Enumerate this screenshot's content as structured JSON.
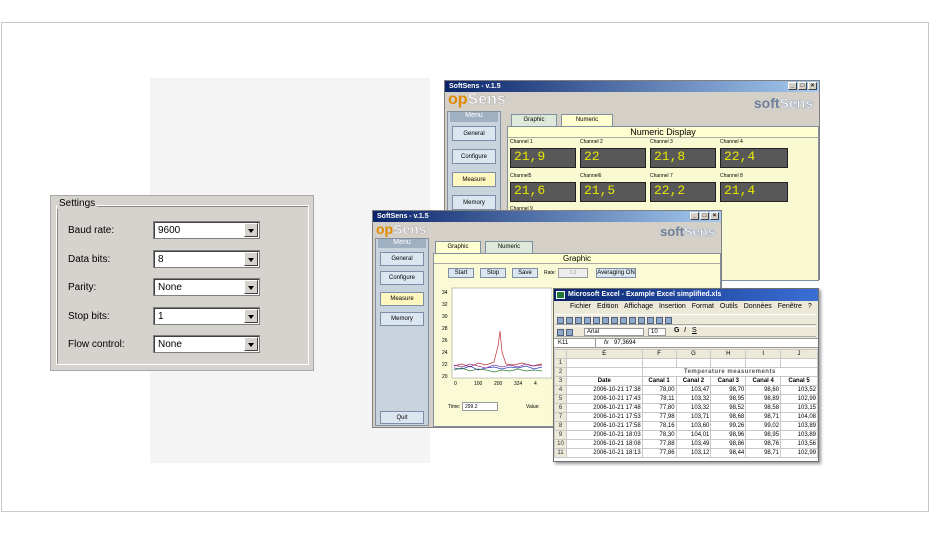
{
  "settings": {
    "title": "Settings",
    "rows": [
      {
        "label": "Baud rate:",
        "value": "9600"
      },
      {
        "label": "Data bits:",
        "value": "8"
      },
      {
        "label": "Parity:",
        "value": "None"
      },
      {
        "label": "Stop bits:",
        "value": "1"
      },
      {
        "label": "Flow control:",
        "value": "None"
      }
    ]
  },
  "back_window": {
    "title": "SoftSens - v.1.5",
    "logo_left": {
      "a": "op",
      "b": "Sens"
    },
    "logo_right": {
      "a": "soft",
      "b": "Sens"
    },
    "menu_title": "Menu",
    "menu": [
      "General",
      "Configure",
      "Measure",
      "Memory"
    ],
    "tabs": [
      "Graphic",
      "Numeric"
    ],
    "panel_title": "Numeric Display",
    "channels": [
      {
        "name": "Channel 1",
        "value": "21,9"
      },
      {
        "name": "Channel 2",
        "value": "22"
      },
      {
        "name": "Channel 3",
        "value": "21,8"
      },
      {
        "name": "Channel 4",
        "value": "22,4"
      },
      {
        "name": "Channel5",
        "value": "21,6"
      },
      {
        "name": "Channel6",
        "value": "21,5"
      },
      {
        "name": "Channel 7",
        "value": "22,2"
      },
      {
        "name": "Channel 8",
        "value": "21,4"
      }
    ],
    "channel_9": "Channel 9"
  },
  "front_window": {
    "title": "SoftSens - v.1.5",
    "logo_left": {
      "a": "op",
      "b": "Sens"
    },
    "logo_right": {
      "a": "soft",
      "b": "Sens"
    },
    "menu_title": "Menu",
    "menu": [
      "General",
      "Configure",
      "Measure",
      "Memory"
    ],
    "quit": "Quit",
    "tabs": [
      "Graphic",
      "Numeric"
    ],
    "panel_title": "Graphic",
    "buttons": {
      "start": "Start",
      "stop": "Stop",
      "save": "Save",
      "rate_label": "Rate:",
      "rate_value": "1.0",
      "averaging": "Averaging ON"
    },
    "time_label": "Time:",
    "time_value": "299.2",
    "value_label": "Value:",
    "y_ticks": [
      "34",
      "32",
      "30",
      "28",
      "26",
      "24",
      "22",
      "20"
    ],
    "x_ticks": [
      "0",
      "100",
      "200",
      "324",
      "4"
    ]
  },
  "excel": {
    "title": "Microsoft Excel - Example Excel simplified.xls",
    "menu": [
      "Fichier",
      "Edition",
      "Affichage",
      "Insertion",
      "Format",
      "Outils",
      "Données",
      "Fenêtre",
      "?"
    ],
    "font": "Arial",
    "font_size": "10",
    "cell_ref": "K11",
    "cell_value": "97,3694",
    "col_headers": [
      "E",
      "F",
      "G",
      "H",
      "I",
      "J"
    ],
    "sheet_title": "Temperature measurements",
    "table_headers": [
      "Date",
      "Canal 1",
      "Canal 2",
      "Canal 3",
      "Canal 4",
      "Canal 5"
    ],
    "rows": [
      [
        "2006-10-21 17:38",
        "78,00",
        "103,47",
        "98,70",
        "98,60",
        "103,52"
      ],
      [
        "2006-10-21 17:43",
        "78,11",
        "103,32",
        "98,95",
        "98,89",
        "102,99"
      ],
      [
        "2006-10-21 17:48",
        "77,80",
        "103,32",
        "98,52",
        "98,58",
        "103,15"
      ],
      [
        "2006-10-21 17:53",
        "77,98",
        "103,71",
        "98,68",
        "98,71",
        "104,08"
      ],
      [
        "2006-10-21 17:58",
        "78,16",
        "103,60",
        "99,26",
        "99,02",
        "103,89"
      ],
      [
        "2006-10-21 18:03",
        "78,30",
        "104,01",
        "98,96",
        "98,95",
        "103,89"
      ],
      [
        "2006-10-21 18:08",
        "77,88",
        "103,49",
        "98,86",
        "98,76",
        "103,56"
      ],
      [
        "2006-10-21 18:13",
        "77,86",
        "103,12",
        "98,44",
        "98,71",
        "102,99"
      ]
    ]
  }
}
